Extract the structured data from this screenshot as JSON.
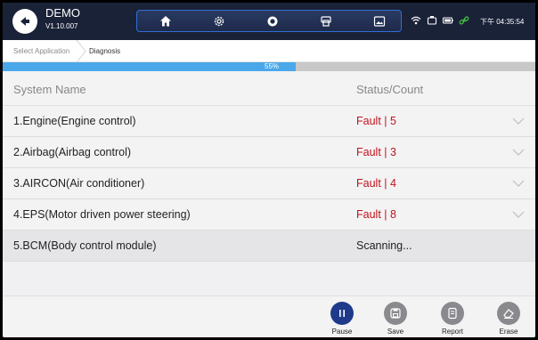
{
  "header": {
    "title": "DEMO",
    "version": "V1.10.007",
    "toolbar_icons": [
      "home-icon",
      "gear-icon",
      "record-icon",
      "printer-icon",
      "image-icon"
    ],
    "status_icons": [
      "wifi-icon",
      "vci-icon",
      "battery-icon",
      "link-icon"
    ],
    "time": "下午 04:35:54"
  },
  "breadcrumb": {
    "items": [
      "Select Application",
      "Diagnosis"
    ]
  },
  "progress": {
    "percent": 55,
    "label": "55%",
    "fill_color": "#4aa8ea"
  },
  "table": {
    "headers": {
      "name": "System Name",
      "status": "Status/Count"
    },
    "rows": [
      {
        "name": "1.Engine(Engine control)",
        "status": "Fault | 5",
        "expandable": true
      },
      {
        "name": "2.Airbag(Airbag control)",
        "status": "Fault | 3",
        "expandable": true
      },
      {
        "name": "3.AIRCON(Air conditioner)",
        "status": "Fault | 4",
        "expandable": true
      },
      {
        "name": "4.EPS(Motor driven power steering)",
        "status": "Fault | 8",
        "expandable": true
      },
      {
        "name": "5.BCM(Body control module)",
        "status": "Scanning...",
        "expandable": false
      }
    ],
    "fault_color": "#c0141c"
  },
  "actions": {
    "pause": "Pause",
    "save": "Save",
    "report": "Report",
    "erase": "Erase"
  }
}
